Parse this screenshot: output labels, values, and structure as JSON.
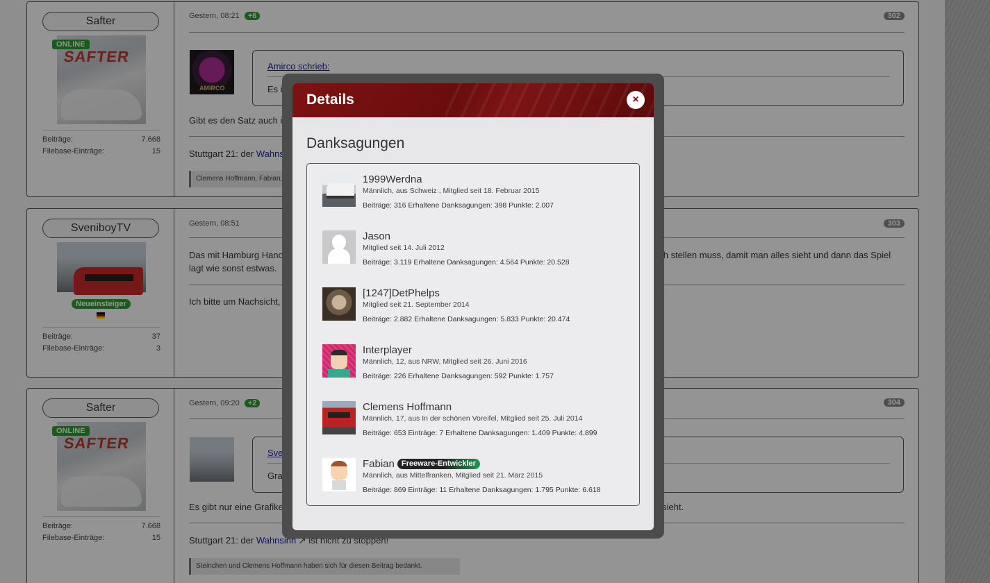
{
  "background": {
    "posts": [
      {
        "author": "Safter",
        "online_label": "ONLINE",
        "stats": [
          {
            "label": "Beiträge:",
            "value": "7.668"
          },
          {
            "label": "Filebase-Einträge:",
            "value": "15"
          }
        ],
        "time": "Gestern, 08:21",
        "likes": "+6",
        "number": "302",
        "quote_author": "Amirco schrieb:",
        "quote_text": "Es ist j",
        "quote_avatar_label": "AMIRCO",
        "text_lines": [
          "Gibt es den Satz auch in v",
          "Stuttgart 21: der "
        ],
        "link": "Wahnsinn",
        "thanks": "Clemens Hoffmann, Fabian,"
      },
      {
        "author": "SveniboyTV",
        "rank": "Neueinsteiger",
        "stats": [
          {
            "label": "Beiträge:",
            "value": "37"
          },
          {
            "label": "Filebase-Einträge:",
            "value": "3"
          }
        ],
        "time": "Gestern, 08:51",
        "number": "303",
        "text_line1_left": "Das mit Hamburg Hanover",
        "text_line1_right": "och stellen muss, damit man alles sieht und dann das Spiel",
        "text_line2": "lagt wie sonst estwas.",
        "text_line3": "Ich bitte um Nachsicht, w"
      },
      {
        "author": "Safter",
        "online_label": "ONLINE",
        "stats": [
          {
            "label": "Beiträge:",
            "value": "7.668"
          },
          {
            "label": "Filebase-Einträge:",
            "value": "15"
          }
        ],
        "time": "Gestern, 09:20",
        "likes": "+2",
        "number": "304",
        "quote_author": "Svenib",
        "quote_text": "Grafik",
        "text_left": "Es gibt nur eine Grafikein",
        "text_right": "s sieht.",
        "sig_prefix": "Stuttgart 21: der ",
        "link": "Wahnsinn",
        "sig_suffix": " ist nicht zu stoppen!",
        "thanks": "Steinchen und Clemens Hoffmann haben sich für diesen Beitrag bedankt."
      }
    ]
  },
  "dialog": {
    "title": "Details",
    "close_icon": "×",
    "section_title": "Danksagungen",
    "users": [
      {
        "name": "1999Werdna",
        "badge": "",
        "info": "Männlich, aus Schweiz , Mitglied seit 18. Februar 2015",
        "stats": "Beiträge: 316  Erhaltene Danksagungen: 398  Punkte: 2.007"
      },
      {
        "name": "Jason",
        "badge": "",
        "info": "Mitglied seit 14. Juli 2012",
        "stats": "Beiträge: 3.119  Erhaltene Danksagungen: 4.564  Punkte: 20.528"
      },
      {
        "name": "[1247]DetPhelps",
        "badge": "",
        "info": "Mitglied seit 21. September 2014",
        "stats": "Beiträge: 2.882  Erhaltene Danksagungen: 5.833  Punkte: 20.474"
      },
      {
        "name": "Interplayer",
        "badge": "",
        "info": "Männlich, 12, aus NRW, Mitglied seit 26. Juni 2016",
        "stats": "Beiträge: 226  Erhaltene Danksagungen: 592  Punkte: 1.757"
      },
      {
        "name": "Clemens Hoffmann",
        "badge": "",
        "info": "Männlich, 17, aus In der schönen Voreifel, Mitglied seit 25. Juli 2014",
        "stats": "Beiträge: 653  Einträge: 7  Erhaltene Danksagungen: 1.409  Punkte: 4.899"
      },
      {
        "name": "Fabian",
        "badge": "Freeware-Entwickler",
        "info": "Männlich, aus Mittelfranken, Mitglied seit 21. März 2015",
        "stats": "Beiträge: 869  Einträge: 11  Erhaltene Danksagungen: 1.795  Punkte: 6.618"
      }
    ]
  }
}
